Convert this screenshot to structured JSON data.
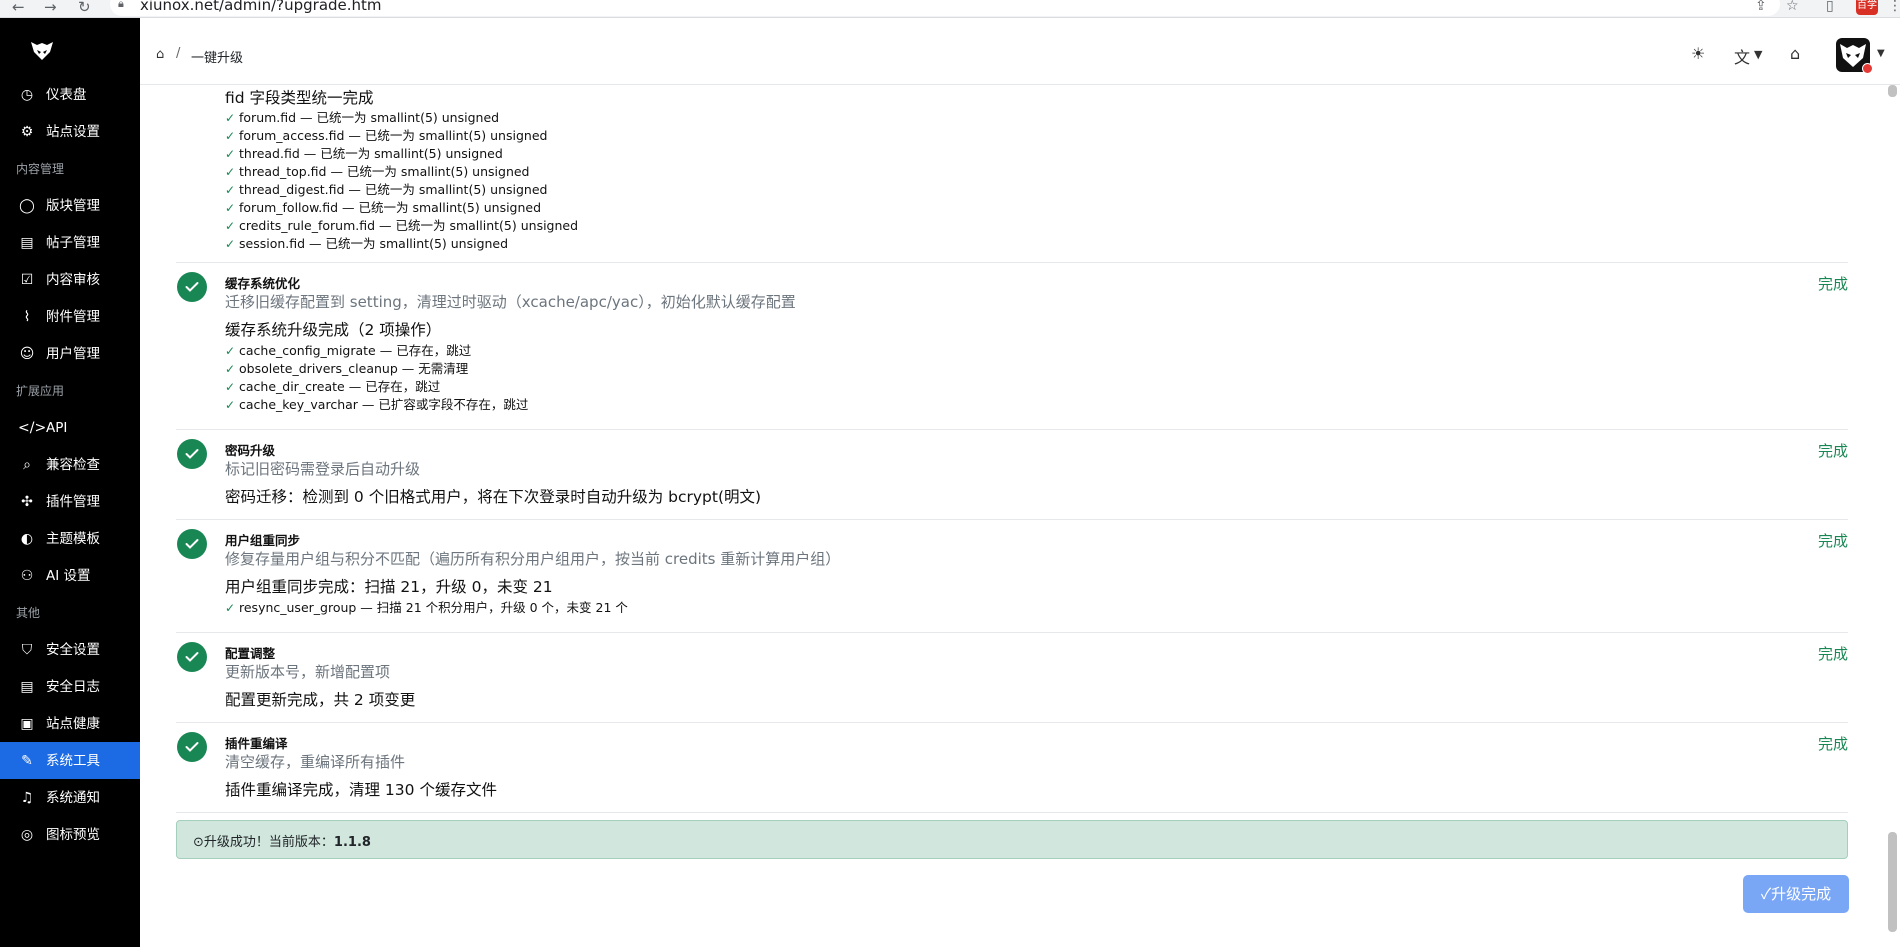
{
  "browser": {
    "url": "xiunox.net/admin/?upgrade.htm",
    "profile_label": "百学"
  },
  "sidebar": {
    "items_top": [
      {
        "icon": "dashboard-icon",
        "glyph": "◷",
        "label": "仪表盘"
      },
      {
        "icon": "gear-icon",
        "glyph": "⚙",
        "label": "站点设置"
      }
    ],
    "section_content": "内容管理",
    "items_content": [
      {
        "icon": "chat-icon",
        "glyph": "◯",
        "label": "版块管理"
      },
      {
        "icon": "document-icon",
        "glyph": "▤",
        "label": "帖子管理"
      },
      {
        "icon": "clipboard-check-icon",
        "glyph": "☑",
        "label": "内容审核"
      },
      {
        "icon": "paperclip-icon",
        "glyph": "⌇",
        "label": "附件管理"
      },
      {
        "icon": "users-icon",
        "glyph": "☺",
        "label": "用户管理"
      }
    ],
    "section_ext": "扩展应用",
    "items_ext": [
      {
        "icon": "code-icon",
        "glyph": "</>",
        "label": "API"
      },
      {
        "icon": "search-icon",
        "glyph": "⌕",
        "label": "兼容检查"
      },
      {
        "icon": "puzzle-icon",
        "glyph": "✣",
        "label": "插件管理"
      },
      {
        "icon": "palette-icon",
        "glyph": "◐",
        "label": "主题模板"
      },
      {
        "icon": "robot-icon",
        "glyph": "⚇",
        "label": "AI 设置"
      }
    ],
    "section_other": "其他",
    "items_other": [
      {
        "icon": "shield-icon",
        "glyph": "⛉",
        "label": "安全设置"
      },
      {
        "icon": "log-icon",
        "glyph": "▤",
        "label": "安全日志"
      },
      {
        "icon": "monitor-icon",
        "glyph": "▣",
        "label": "站点健康"
      },
      {
        "icon": "wrench-icon",
        "glyph": "✎",
        "label": "系统工具",
        "active": true
      },
      {
        "icon": "bell-icon",
        "glyph": "♫",
        "label": "系统通知"
      },
      {
        "icon": "icons-icon",
        "glyph": "◎",
        "label": "图标预览"
      }
    ]
  },
  "header": {
    "breadcrumb_sep": "/",
    "breadcrumb_current": "一键升级"
  },
  "fid_block": {
    "result": "fid 字段类型统一完成",
    "details": [
      "forum.fid — 已统一为 smallint(5) unsigned",
      "forum_access.fid — 已统一为 smallint(5) unsigned",
      "thread.fid — 已统一为 smallint(5) unsigned",
      "thread_top.fid — 已统一为 smallint(5) unsigned",
      "thread_digest.fid — 已统一为 smallint(5) unsigned",
      "forum_follow.fid — 已统一为 smallint(5) unsigned",
      "credits_rule_forum.fid — 已统一为 smallint(5) unsigned",
      "session.fid — 已统一为 smallint(5) unsigned"
    ]
  },
  "steps": [
    {
      "title": "缓存系统优化",
      "desc": "迁移旧缓存配置到 setting，清理过时驱动（xcache/apc/yac），初始化默认缓存配置",
      "result": "缓存系统升级完成（2 项操作）",
      "status": "完成",
      "details": [
        "cache_config_migrate — 已存在，跳过",
        "obsolete_drivers_cleanup — 无需清理",
        "cache_dir_create — 已存在，跳过",
        "cache_key_varchar — 已扩容或字段不存在，跳过"
      ]
    },
    {
      "title": "密码升级",
      "desc": "标记旧密码需登录后自动升级",
      "result": "密码迁移：检测到 0 个旧格式用户，将在下次登录时自动升级为 bcrypt(明文)",
      "status": "完成",
      "details": []
    },
    {
      "title": "用户组重同步",
      "desc": "修复存量用户组与积分不匹配（遍历所有积分用户组用户，按当前 credits 重新计算用户组）",
      "result": "用户组重同步完成：扫描 21，升级 0，未变 21",
      "status": "完成",
      "details": [
        "resync_user_group — 扫描 21 个积分用户，升级 0 个，未变 21 个"
      ]
    },
    {
      "title": "配置调整",
      "desc": "更新版本号，新增配置项",
      "result": "配置更新完成，共 2 项变更",
      "status": "完成",
      "details": []
    },
    {
      "title": "插件重编译",
      "desc": "清空缓存，重编译所有插件",
      "result": "插件重编译完成，清理 130 个缓存文件",
      "status": "完成",
      "details": []
    }
  ],
  "success": {
    "icon": "check-circle-icon",
    "label": "升级成功！当前版本：",
    "version": "1.1.8"
  },
  "done_button": "✓升级完成",
  "colors": {
    "sidebar_bg": "#000000",
    "active_item": "#1c6be5",
    "success_green": "#198754",
    "alert_bg": "#d1e7dd",
    "button_bg": "#7aa7f5"
  }
}
